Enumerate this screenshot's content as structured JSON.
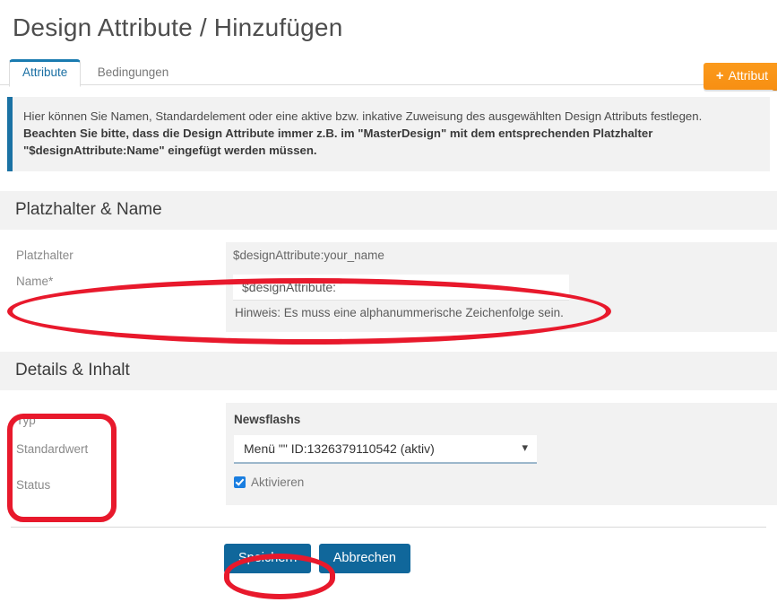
{
  "page": {
    "title": "Design Attribute / Hinzufügen"
  },
  "tabs": [
    {
      "label": "Attribute",
      "active": true
    },
    {
      "label": "Bedingungen",
      "active": false
    }
  ],
  "toolbar": {
    "add_label": "Attribut",
    "add_icon": "plus-icon"
  },
  "infobox": {
    "line1": "Hier können Sie Namen, Standardelement oder eine aktive bzw. inkative Zuweisung des ausgewählten Design Attributs festlegen.",
    "line2": "Beachten Sie bitte, dass die Design Attribute immer z.B. im \"MasterDesign\" mit dem entsprechenden Platzhalter",
    "line3": "\"$designAttribute:Name\" eingefügt werden müssen."
  },
  "section_placeholder": {
    "heading": "Platzhalter & Name",
    "placeholder_label": "Platzhalter",
    "placeholder_value": "$designAttribute:your_name",
    "name_label": "Name*",
    "name_value": "$designAttribute:",
    "name_hint": "Hinweis: Es muss eine alphanummerische Zeichenfolge sein."
  },
  "section_details": {
    "heading": "Details & Inhalt",
    "labels": {
      "typ": "Typ",
      "standardwert": "Standardwert",
      "status": "Status"
    },
    "panel_title": "Newsflashs",
    "select_value": "Menü \"\" ID:1326379110542 (aktiv)",
    "select_chevron": "chevron-down-icon",
    "checkbox_label": "Aktivieren",
    "checkbox_checked": true
  },
  "footer": {
    "save_label": "Speichern",
    "cancel_label": "Abbrechen"
  },
  "colors": {
    "accent_blue": "#10679b",
    "tab_blue": "#1a7bb0",
    "info_border": "#1b72a4",
    "orange": "#f7941e",
    "annotation_red": "#e8192c",
    "panel_gray": "#f2f2f2"
  }
}
